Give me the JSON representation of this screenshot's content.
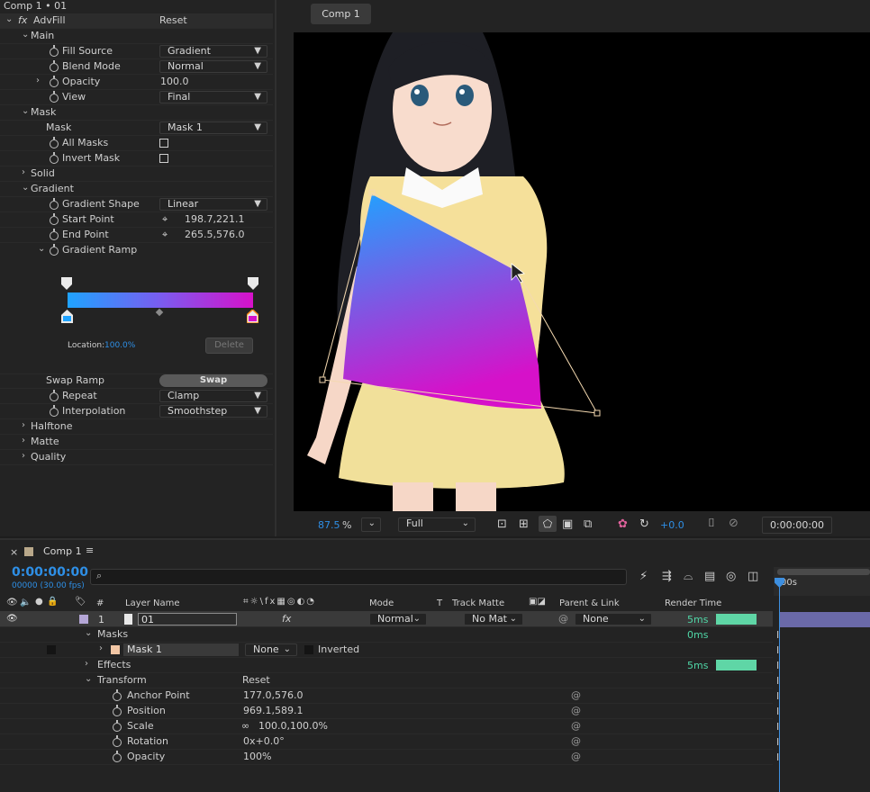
{
  "effect_panel": {
    "title": "Comp 1 • 01",
    "effect_name": "AdvFill",
    "reset": "Reset",
    "main_group": "Main",
    "fill_source": {
      "label": "Fill Source",
      "value": "Gradient"
    },
    "blend_mode": {
      "label": "Blend Mode",
      "value": "Normal"
    },
    "opacity": {
      "label": "Opacity",
      "value": "100.0"
    },
    "view": {
      "label": "View",
      "value": "Final"
    },
    "mask_group": "Mask",
    "mask": {
      "label": "Mask",
      "value": "Mask 1"
    },
    "all_masks": {
      "label": "All Masks"
    },
    "invert_mask": {
      "label": "Invert Mask"
    },
    "solid_group": "Solid",
    "gradient_group": "Gradient",
    "gradient_shape": {
      "label": "Gradient Shape",
      "value": "Linear"
    },
    "start_point": {
      "label": "Start Point",
      "value": "198.7,221.1"
    },
    "end_point": {
      "label": "End Point",
      "value": "265.5,576.0"
    },
    "gradient_ramp": "Gradient Ramp",
    "ramp_colors": [
      "#1fa3ff",
      "#d611c9"
    ],
    "location_label": "Location:",
    "location_value": "100.0%",
    "delete_label": "Delete",
    "swap_ramp": {
      "label": "Swap Ramp",
      "button": "Swap"
    },
    "repeat": {
      "label": "Repeat",
      "value": "Clamp"
    },
    "interpolation": {
      "label": "Interpolation",
      "value": "Smoothstep"
    },
    "halftone_group": "Halftone",
    "matte_group": "Matte",
    "quality_group": "Quality"
  },
  "viewer": {
    "tab": "Comp 1",
    "zoom": "87.5",
    "zoom_unit": "%",
    "resolution": "Full",
    "exposure": "+0.0",
    "timecode": "0:00:00:00"
  },
  "timeline": {
    "tab": "Comp 1",
    "timecode": "0:00:00:00",
    "frames": "00000 (30.00 fps)",
    "ruler_label": "00s",
    "headers": {
      "num": "#",
      "layer_name": "Layer Name",
      "mode": "Mode",
      "t": "T",
      "track_matte": "Track Matte",
      "parent": "Parent & Link",
      "render_time": "Render Time"
    },
    "layer": {
      "num": "1",
      "name": "01",
      "mode": "Normal",
      "matte": "No Mat",
      "parent": "None",
      "render": "5ms"
    },
    "masks_label": "Masks",
    "masks_render": "0ms",
    "mask1": {
      "name": "Mask 1",
      "mode": "None",
      "inverted": "Inverted"
    },
    "effects_label": "Effects",
    "effects_render": "5ms",
    "transform_label": "Transform",
    "transform_reset": "Reset",
    "props": [
      {
        "name": "Anchor Point",
        "value": "177.0,576.0"
      },
      {
        "name": "Position",
        "value": "969.1,589.1"
      },
      {
        "name": "Scale",
        "value": "100.0,100.0%"
      },
      {
        "name": "Rotation",
        "value": "0x+0.0°"
      },
      {
        "name": "Opacity",
        "value": "100%"
      }
    ]
  }
}
